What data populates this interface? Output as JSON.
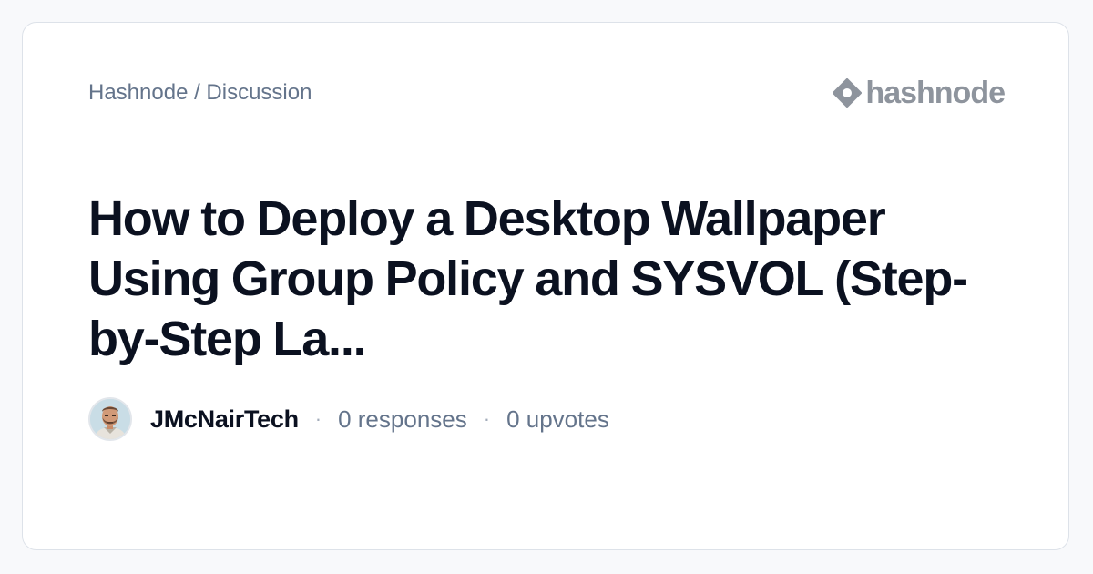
{
  "breadcrumb": "Hashnode / Discussion",
  "brand": {
    "name": "hashnode",
    "icon": "hashnode-logo-icon",
    "color": "#8e949d"
  },
  "post": {
    "title": "How to Deploy a Desktop Wallpaper Using Group Policy and SYSVOL (Step-by-Step La..."
  },
  "meta": {
    "author": "JMcNairTech",
    "separator": "·",
    "responses": "0 responses",
    "upvotes": "0 upvotes"
  },
  "colors": {
    "title": "#0b1120",
    "muted": "#64748b",
    "background": "#f8f9fb",
    "card": "#ffffff"
  }
}
